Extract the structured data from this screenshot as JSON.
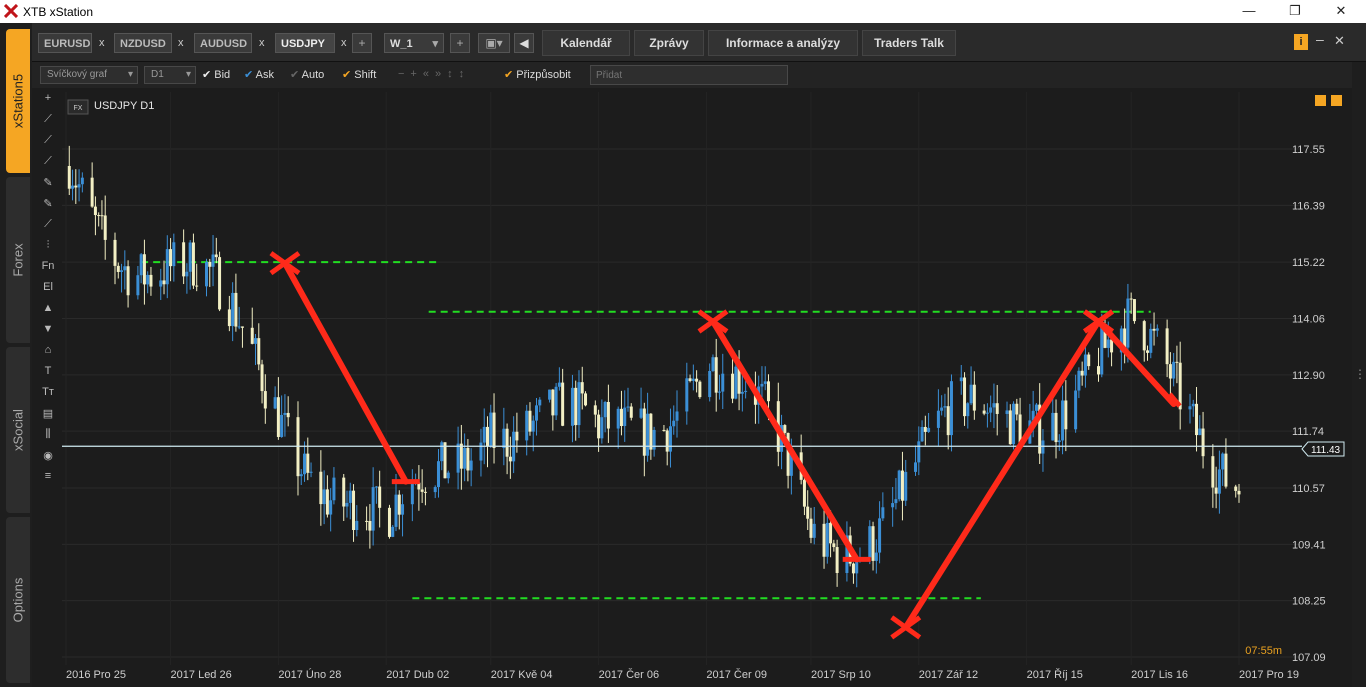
{
  "window": {
    "title": "XTB xStation",
    "minimize": "—",
    "restore": "❐",
    "close": "✕"
  },
  "side_tabs": [
    {
      "label": "xStation5",
      "active": true
    },
    {
      "label": "Forex",
      "active": false
    },
    {
      "label": "xSocial",
      "active": false
    },
    {
      "label": "Options",
      "active": false
    }
  ],
  "symbol_tabs": [
    {
      "label": "EURUSD",
      "close": "x"
    },
    {
      "label": "NZDUSD",
      "close": "x"
    },
    {
      "label": "AUDUSD",
      "close": "x"
    },
    {
      "label": "USDJPY",
      "close": "x"
    }
  ],
  "tabbar": {
    "add": "+",
    "workspace": "W_1",
    "workspace_add": "+",
    "back": "◀",
    "buttons": [
      "Kalendář",
      "Zprávy",
      "Informace a analýzy",
      "Traders Talk"
    ]
  },
  "toolbar": {
    "chart_type": "Svíčkový graf",
    "timeframe": "D1",
    "bid": "Bid",
    "ask": "Ask",
    "auto": "Auto",
    "shift": "Shift",
    "customize": "Přizpůsobit",
    "add_placeholder": "Přidat"
  },
  "left_tools": [
    "+",
    "⟋",
    "⟋",
    "⟋",
    "✎",
    "✎",
    "⟋",
    "⫶",
    "Fn",
    "El",
    "▲",
    "▼",
    "⌂",
    "T",
    "Tт",
    "▤",
    "⫼",
    "◉",
    "≡"
  ],
  "chart": {
    "badge": "FX",
    "symbol_label": "USDJPY D1",
    "current_price": "111.43",
    "countdown": "07:55m",
    "y_labels": [
      "117.55",
      "116.39",
      "115.22",
      "114.06",
      "112.90",
      "111.74",
      "110.57",
      "109.41",
      "108.25",
      "107.09"
    ],
    "x_labels": [
      "2016 Pro 25",
      "2017 Led 26",
      "2017 Úno 28",
      "2017 Dub 02",
      "2017 Kvě 04",
      "2017 Čer 06",
      "2017 Čer 09",
      "2017 Srp 10",
      "2017 Zář 12",
      "2017 Říj 15",
      "2017 Lis 16",
      "2017 Pro 19"
    ],
    "colors": {
      "background": "#1c1c1c",
      "bull": "#3b8fd6",
      "bear": "#f2efc4",
      "annotation": "#ff2a1a",
      "levels": "#22dd22",
      "price_line": "#cfeaf0",
      "countdown": "#e8a020"
    }
  },
  "chart_data": {
    "type": "candlestick",
    "symbol": "USDJPY",
    "timeframe": "D1",
    "ylim": [
      107.09,
      118.3
    ],
    "x": [
      "2016-12-25",
      "2017-01-26",
      "2017-02-28",
      "2017-04-02",
      "2017-05-04",
      "2017-06-06",
      "2017-07-09",
      "2017-08-10",
      "2017-09-12",
      "2017-10-15",
      "2017-11-16",
      "2017-12-19"
    ],
    "y": [
      117.2,
      115.0,
      112.6,
      109.1,
      112.5,
      111.1,
      113.6,
      109.6,
      110.8,
      112.6,
      113.2,
      111.43
    ],
    "current_price": 111.43,
    "horizontal_levels": [
      115.22,
      114.2,
      108.3
    ],
    "annotation_swings": [
      {
        "from": {
          "x": "2017-03-02",
          "y": 115.2
        },
        "to": {
          "x": "2017-04-08",
          "y": 110.7
        }
      },
      {
        "from": {
          "x": "2017-07-11",
          "y": 114.0
        },
        "to": {
          "x": "2017-08-24",
          "y": 109.1
        }
      },
      {
        "from": {
          "x": "2017-09-08",
          "y": 107.7
        },
        "to": {
          "x": "2017-11-06",
          "y": 114.0
        }
      },
      {
        "from": {
          "x": "2017-11-06",
          "y": 114.0
        },
        "to": {
          "x": "2017-11-29",
          "y": 112.3
        }
      }
    ]
  }
}
